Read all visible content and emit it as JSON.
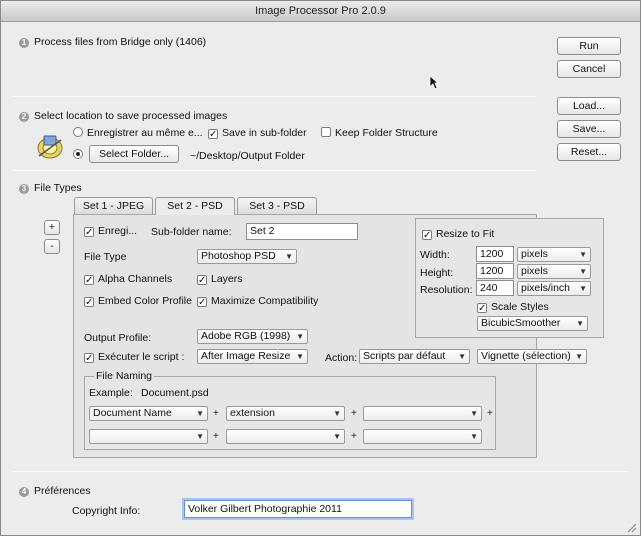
{
  "window": {
    "title": "Image Processor Pro 2.0.9"
  },
  "section1": {
    "num": "1",
    "label": "Process files from Bridge only (1406)"
  },
  "side_buttons": {
    "run": "Run",
    "cancel": "Cancel",
    "load": "Load...",
    "save": "Save...",
    "reset": "Reset..."
  },
  "section2": {
    "num": "2",
    "label": "Select location to save processed images",
    "option_same": "Enregistrer au même e...",
    "save_subfolder": "Save in sub-folder",
    "keep_structure": "Keep Folder Structure",
    "select_folder_button": "Select Folder...",
    "folder_path": "~/Desktop/Output Folder"
  },
  "section3": {
    "num": "3",
    "label": "File Types",
    "add": "+",
    "remove": "-",
    "tabs": [
      "Set 1 - JPEG",
      "Set 2 - PSD",
      "Set 3 - PSD"
    ],
    "active_tab": 1,
    "enregi": "Enregi...",
    "subfolder_label": "Sub-folder name:",
    "subfolder_value": "Set 2",
    "file_type_label": "File Type",
    "file_type_value": "Photoshop PSD",
    "alpha": "Alpha Channels",
    "layers": "Layers",
    "embed_profile": "Embed Color Profile",
    "maximize": "Maximize Compatibility",
    "output_profile_label": "Output Profile:",
    "output_profile_value": "Adobe RGB (1998)",
    "execute_label": "Exécuter le script :",
    "execute_when": "After Image Resize",
    "action_label": "Action:",
    "action_set": "Scripts par défaut",
    "action_name": "Vignette (sélection)",
    "resize": {
      "label": "Resize to Fit",
      "width_label": "Width:",
      "width_value": "1200",
      "width_unit": "pixels",
      "height_label": "Height:",
      "height_value": "1200",
      "height_unit": "pixels",
      "res_label": "Resolution:",
      "res_value": "240",
      "res_unit": "pixels/inch",
      "scale_styles": "Scale Styles",
      "method": "BicubicSmoother"
    },
    "naming": {
      "label": "File Naming",
      "example_label": "Example:",
      "example_value": "Document.psd",
      "row1": [
        "Document Name",
        "extension",
        ""
      ],
      "row2": [
        "",
        "",
        ""
      ],
      "plus": "+"
    }
  },
  "section4": {
    "num": "4",
    "label": "Préférences",
    "copyright_label": "Copyright Info:",
    "copyright_value": "Volker Gilbert Photographie 2011"
  }
}
